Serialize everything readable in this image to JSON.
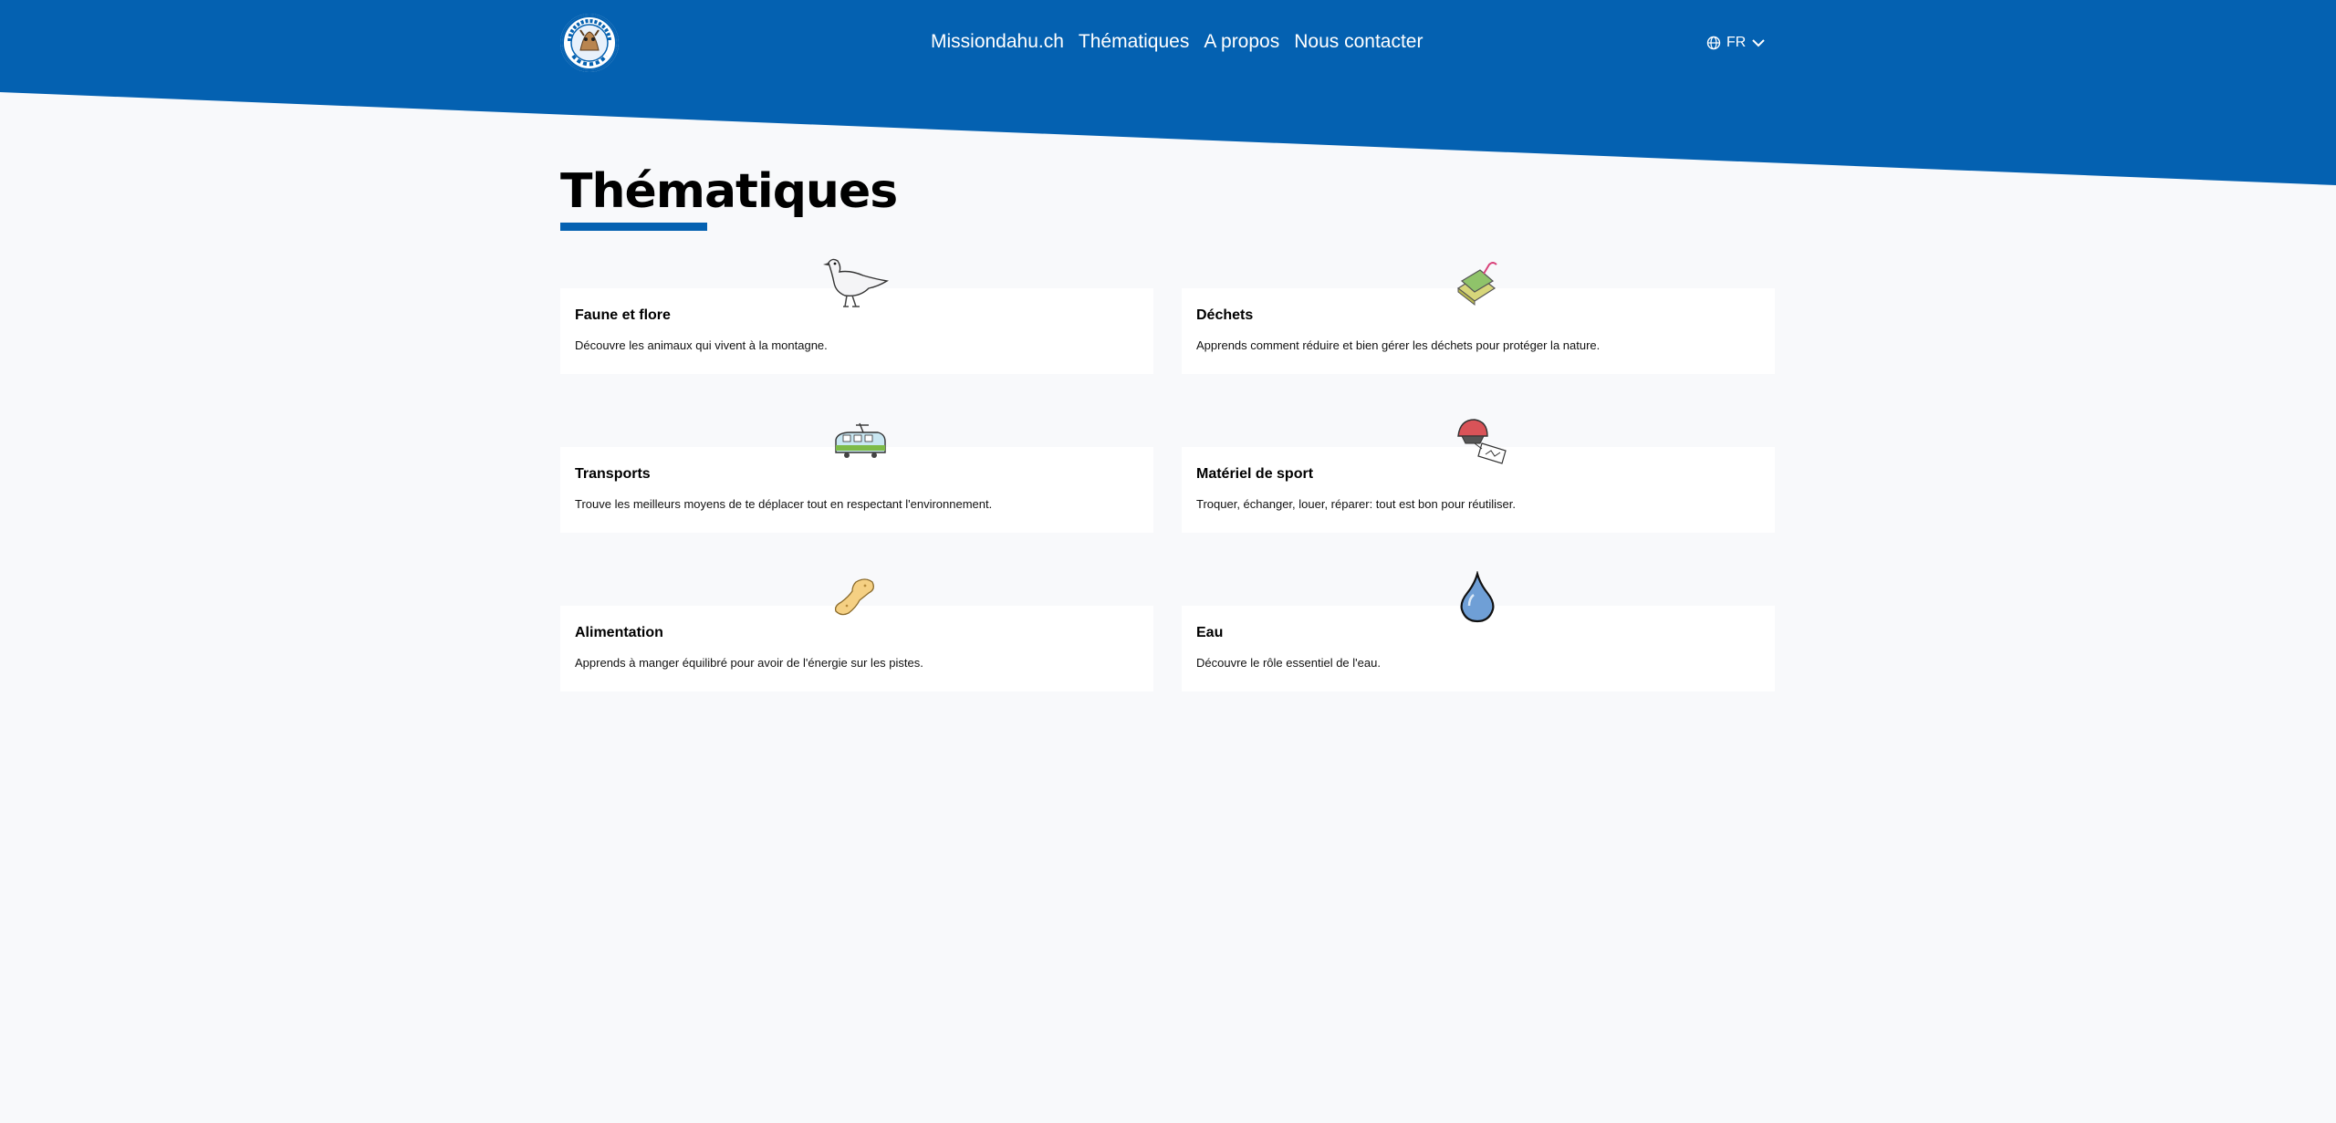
{
  "brand": {
    "primary_color": "#0461b1",
    "background_color": "#f8f9fb",
    "logo_icon": "missiondahu-logo"
  },
  "nav": {
    "items": [
      {
        "label": "Missiondahu.ch"
      },
      {
        "label": "Thématiques"
      },
      {
        "label": "A propos"
      },
      {
        "label": "Nous contacter"
      }
    ],
    "language": {
      "label": "FR",
      "icon": "globe-icon"
    }
  },
  "page": {
    "title": "Thématiques"
  },
  "cards": [
    {
      "title": "Faune et flore",
      "description": "Découvre les animaux qui vivent à la montagne.",
      "icon": "bird-icon"
    },
    {
      "title": "Déchets",
      "description": "Apprends comment réduire et bien gérer les déchets pour protéger la nature.",
      "icon": "juice-box-icon"
    },
    {
      "title": "Transports",
      "description": "Trouve les meilleurs moyens de te déplacer tout en respectant l'environnement.",
      "icon": "train-icon"
    },
    {
      "title": "Matériel de sport",
      "description": "Troquer, échanger, louer, réparer: tout est bon pour réutiliser.",
      "icon": "helmet-icon"
    },
    {
      "title": "Alimentation",
      "description": "Apprends à manger équilibré pour avoir de l'énergie sur les pistes.",
      "icon": "food-icon"
    },
    {
      "title": "Eau",
      "description": "Découvre le rôle essentiel de l'eau.",
      "icon": "water-drop-icon"
    }
  ]
}
